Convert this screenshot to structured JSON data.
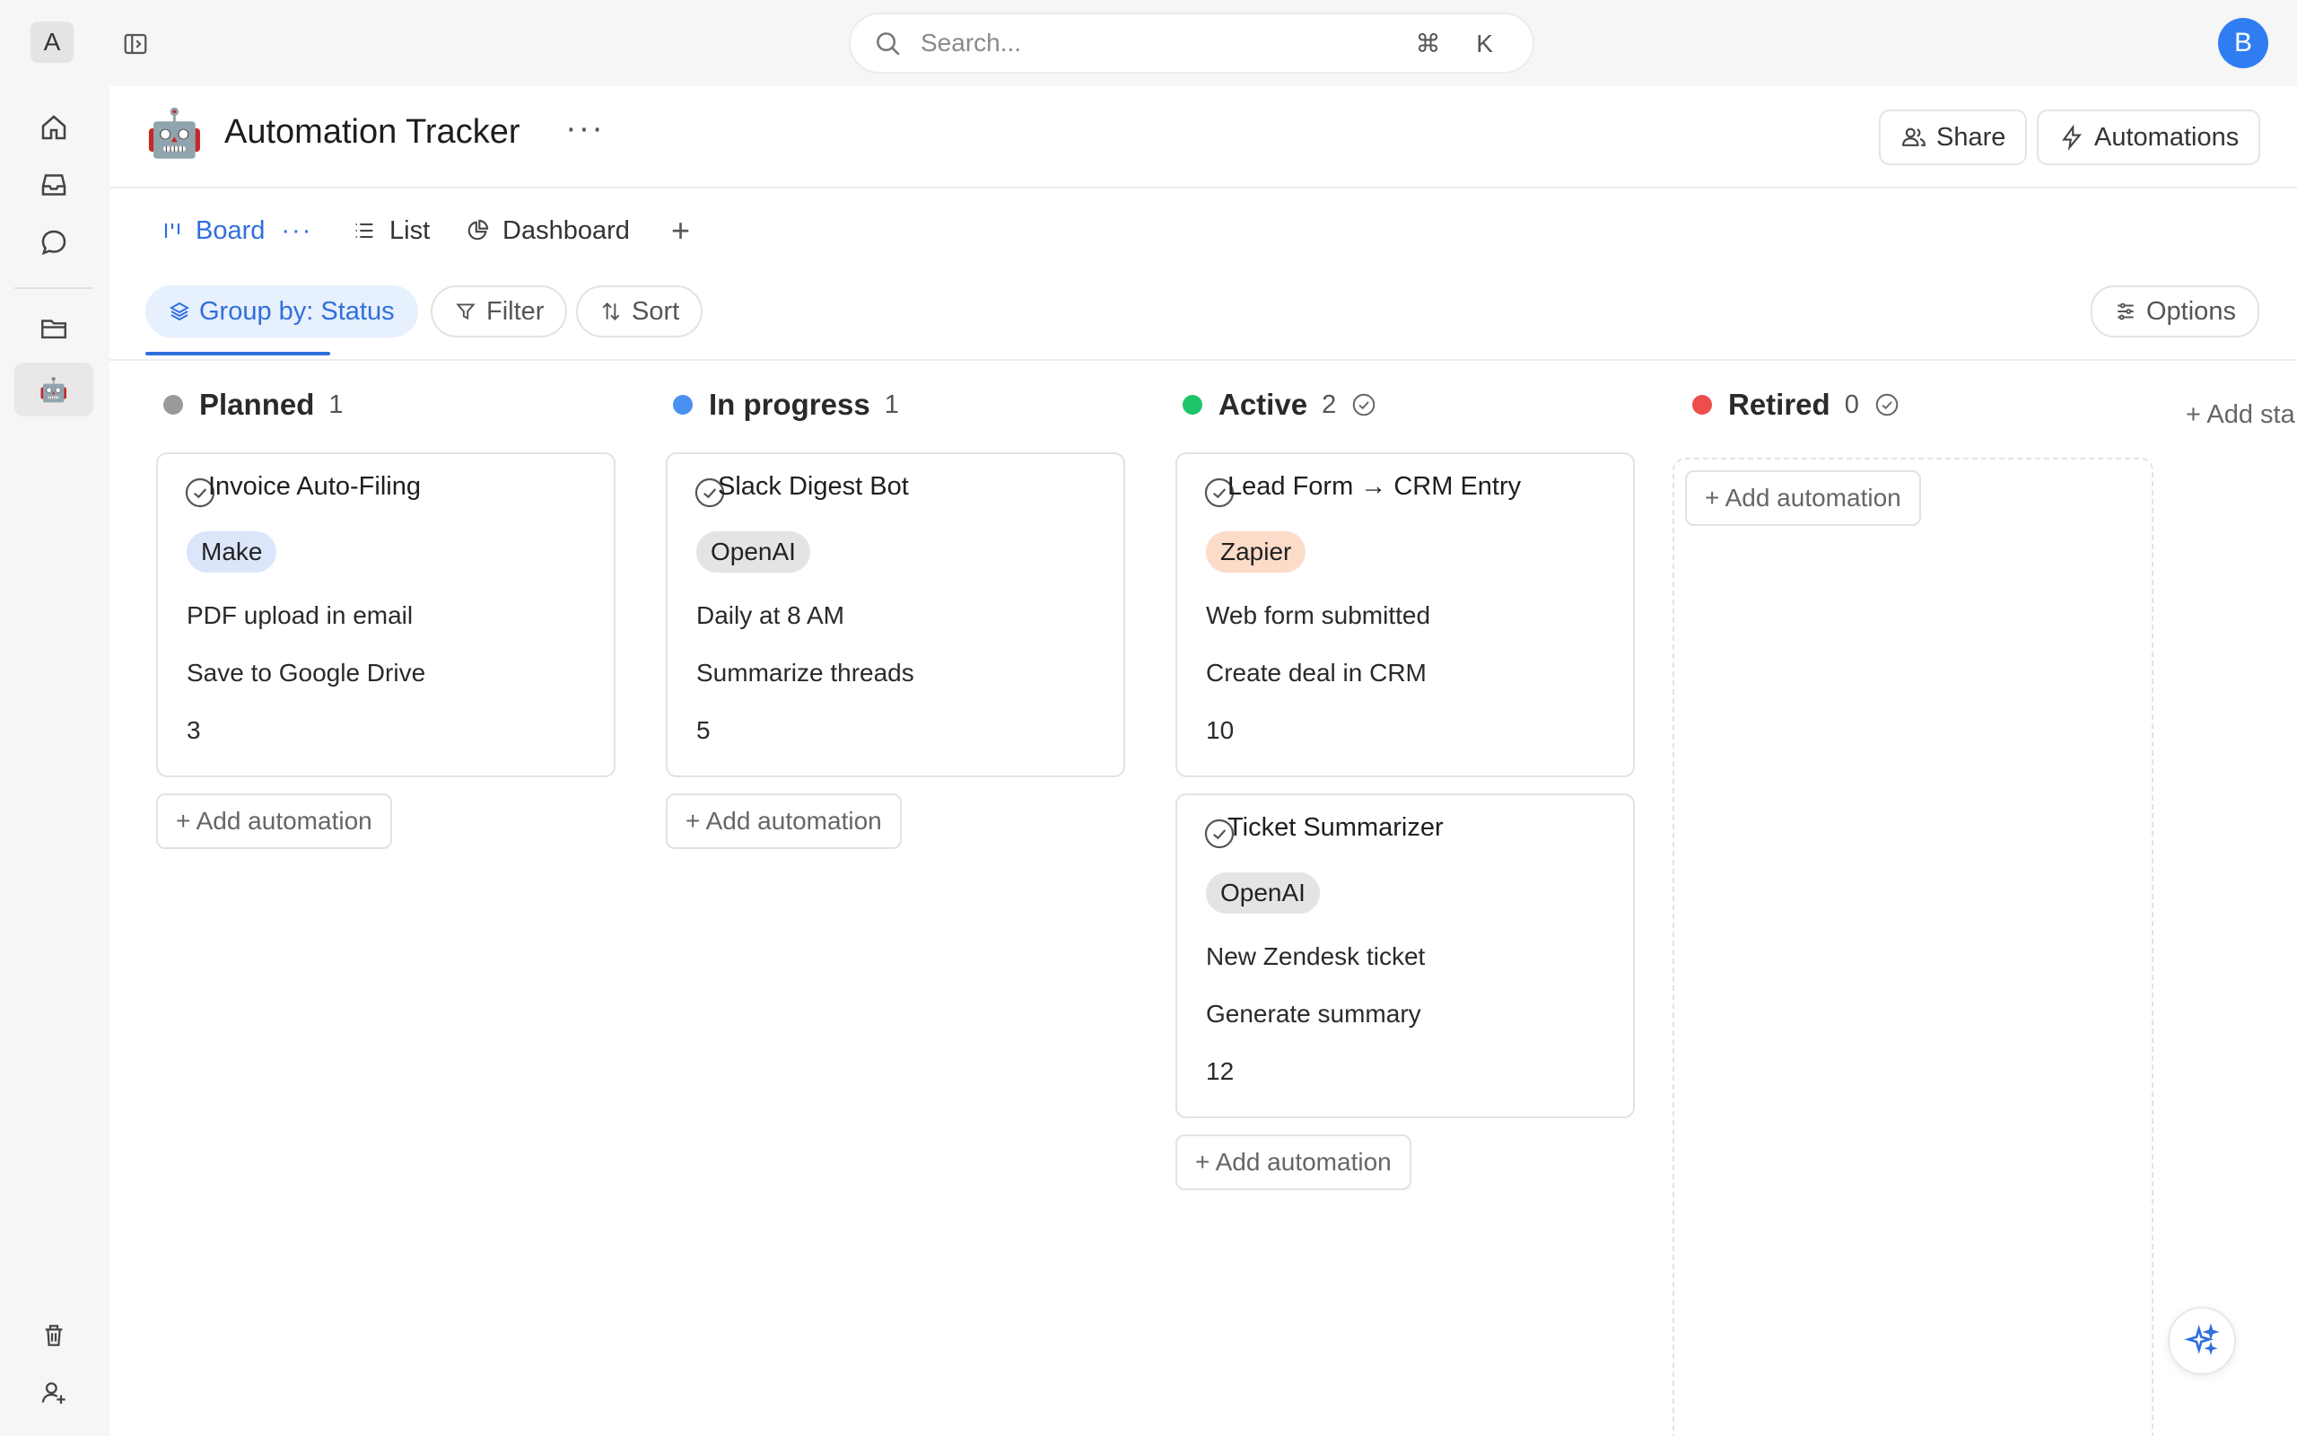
{
  "topbar": {
    "workspace_initial": "A",
    "search_placeholder": "Search...",
    "search_shortcut": "⌘ K",
    "user_initial": "B"
  },
  "page": {
    "icon": "🤖",
    "title": "Automation Tracker",
    "more": "···",
    "share_label": "Share",
    "automations_label": "Automations"
  },
  "tabs": [
    {
      "label": "Board",
      "more": "···"
    },
    {
      "label": "List"
    },
    {
      "label": "Dashboard"
    },
    {
      "label": "+"
    }
  ],
  "toolbar": {
    "group_label": "Group by: Status",
    "filter_label": "Filter",
    "sort_label": "Sort",
    "options_label": "Options"
  },
  "columns": [
    {
      "name": "Planned",
      "count": "1",
      "color": "#9a9a9a",
      "cards": [
        {
          "title": "Invoice Auto-Filing",
          "tag": "Make",
          "tag_color": "#dbe6fb",
          "trigger": "PDF upload in email",
          "action": "Save to Google Drive",
          "value": "3"
        }
      ],
      "add_label": "+ Add automation"
    },
    {
      "name": "In progress",
      "count": "1",
      "color": "#4a90f0",
      "cards": [
        {
          "title": "Slack Digest Bot",
          "tag": "OpenAI",
          "tag_color": "#e4e4e4",
          "trigger": "Daily at 8 AM",
          "action": "Summarize threads",
          "value": "5"
        }
      ],
      "add_label": "+ Add automation"
    },
    {
      "name": "Active",
      "count": "2",
      "color": "#1ec46a",
      "cards": [
        {
          "title": "Lead Form → CRM Entry",
          "tag": "Zapier",
          "tag_color": "#fcdcc8",
          "trigger": "Web form submitted",
          "action": "Create deal in CRM",
          "value": "10"
        },
        {
          "title": "Ticket Summarizer",
          "tag": "OpenAI",
          "tag_color": "#e4e4e4",
          "trigger": "New Zendesk ticket",
          "action": "Generate summary",
          "value": "12"
        }
      ],
      "add_label": "+ Add automation"
    },
    {
      "name": "Retired",
      "count": "0",
      "color": "#ee4d4d",
      "cards": [],
      "add_label": "+ Add automation"
    }
  ],
  "add_status_label": "+ Add sta"
}
